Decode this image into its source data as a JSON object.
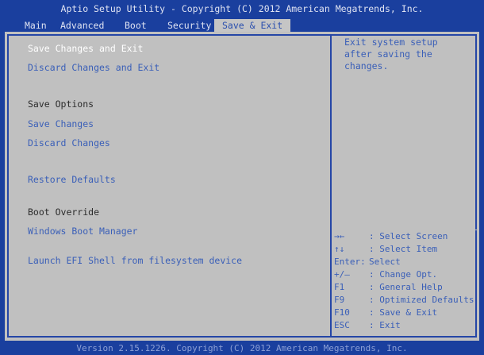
{
  "title": "Aptio Setup Utility - Copyright (C) 2012 American Megatrends, Inc.",
  "tabs": [
    {
      "label": "Main"
    },
    {
      "label": "Advanced"
    },
    {
      "label": "Boot"
    },
    {
      "label": "Security"
    },
    {
      "label": "Save & Exit"
    }
  ],
  "menu": {
    "save_changes_and_exit": "Save Changes and Exit",
    "discard_changes_and_exit": "Discard Changes and Exit",
    "save_options_label": "Save Options",
    "save_changes": "Save Changes",
    "discard_changes": "Discard Changes",
    "restore_defaults": "Restore Defaults",
    "boot_override_label": "Boot Override",
    "windows_boot_manager": "Windows Boot Manager",
    "launch_efi_shell": "Launch EFI Shell from filesystem device"
  },
  "help": {
    "lines": [
      "Exit system setup",
      "after saving the",
      "changes."
    ]
  },
  "keys": [
    {
      "key": "→←",
      "desc": ": Select Screen"
    },
    {
      "key": "↑↓",
      "desc": ": Select Item"
    },
    {
      "key": "Enter:",
      "desc": "Select"
    },
    {
      "key": "+/—",
      "desc": ": Change Opt."
    },
    {
      "key": "F1",
      "desc": ": General Help"
    },
    {
      "key": "F9",
      "desc": ": Optimized Defaults"
    },
    {
      "key": "F10",
      "desc": ": Save & Exit"
    },
    {
      "key": "ESC",
      "desc": ": Exit"
    }
  ],
  "footer": "Version 2.15.1226. Copyright (C) 2012 American Megatrends, Inc.",
  "colors": {
    "background": "#1a3f9e",
    "panel": "#c0c0c0",
    "item_text": "#3a5fb8",
    "selected_text": "#ffffff"
  }
}
